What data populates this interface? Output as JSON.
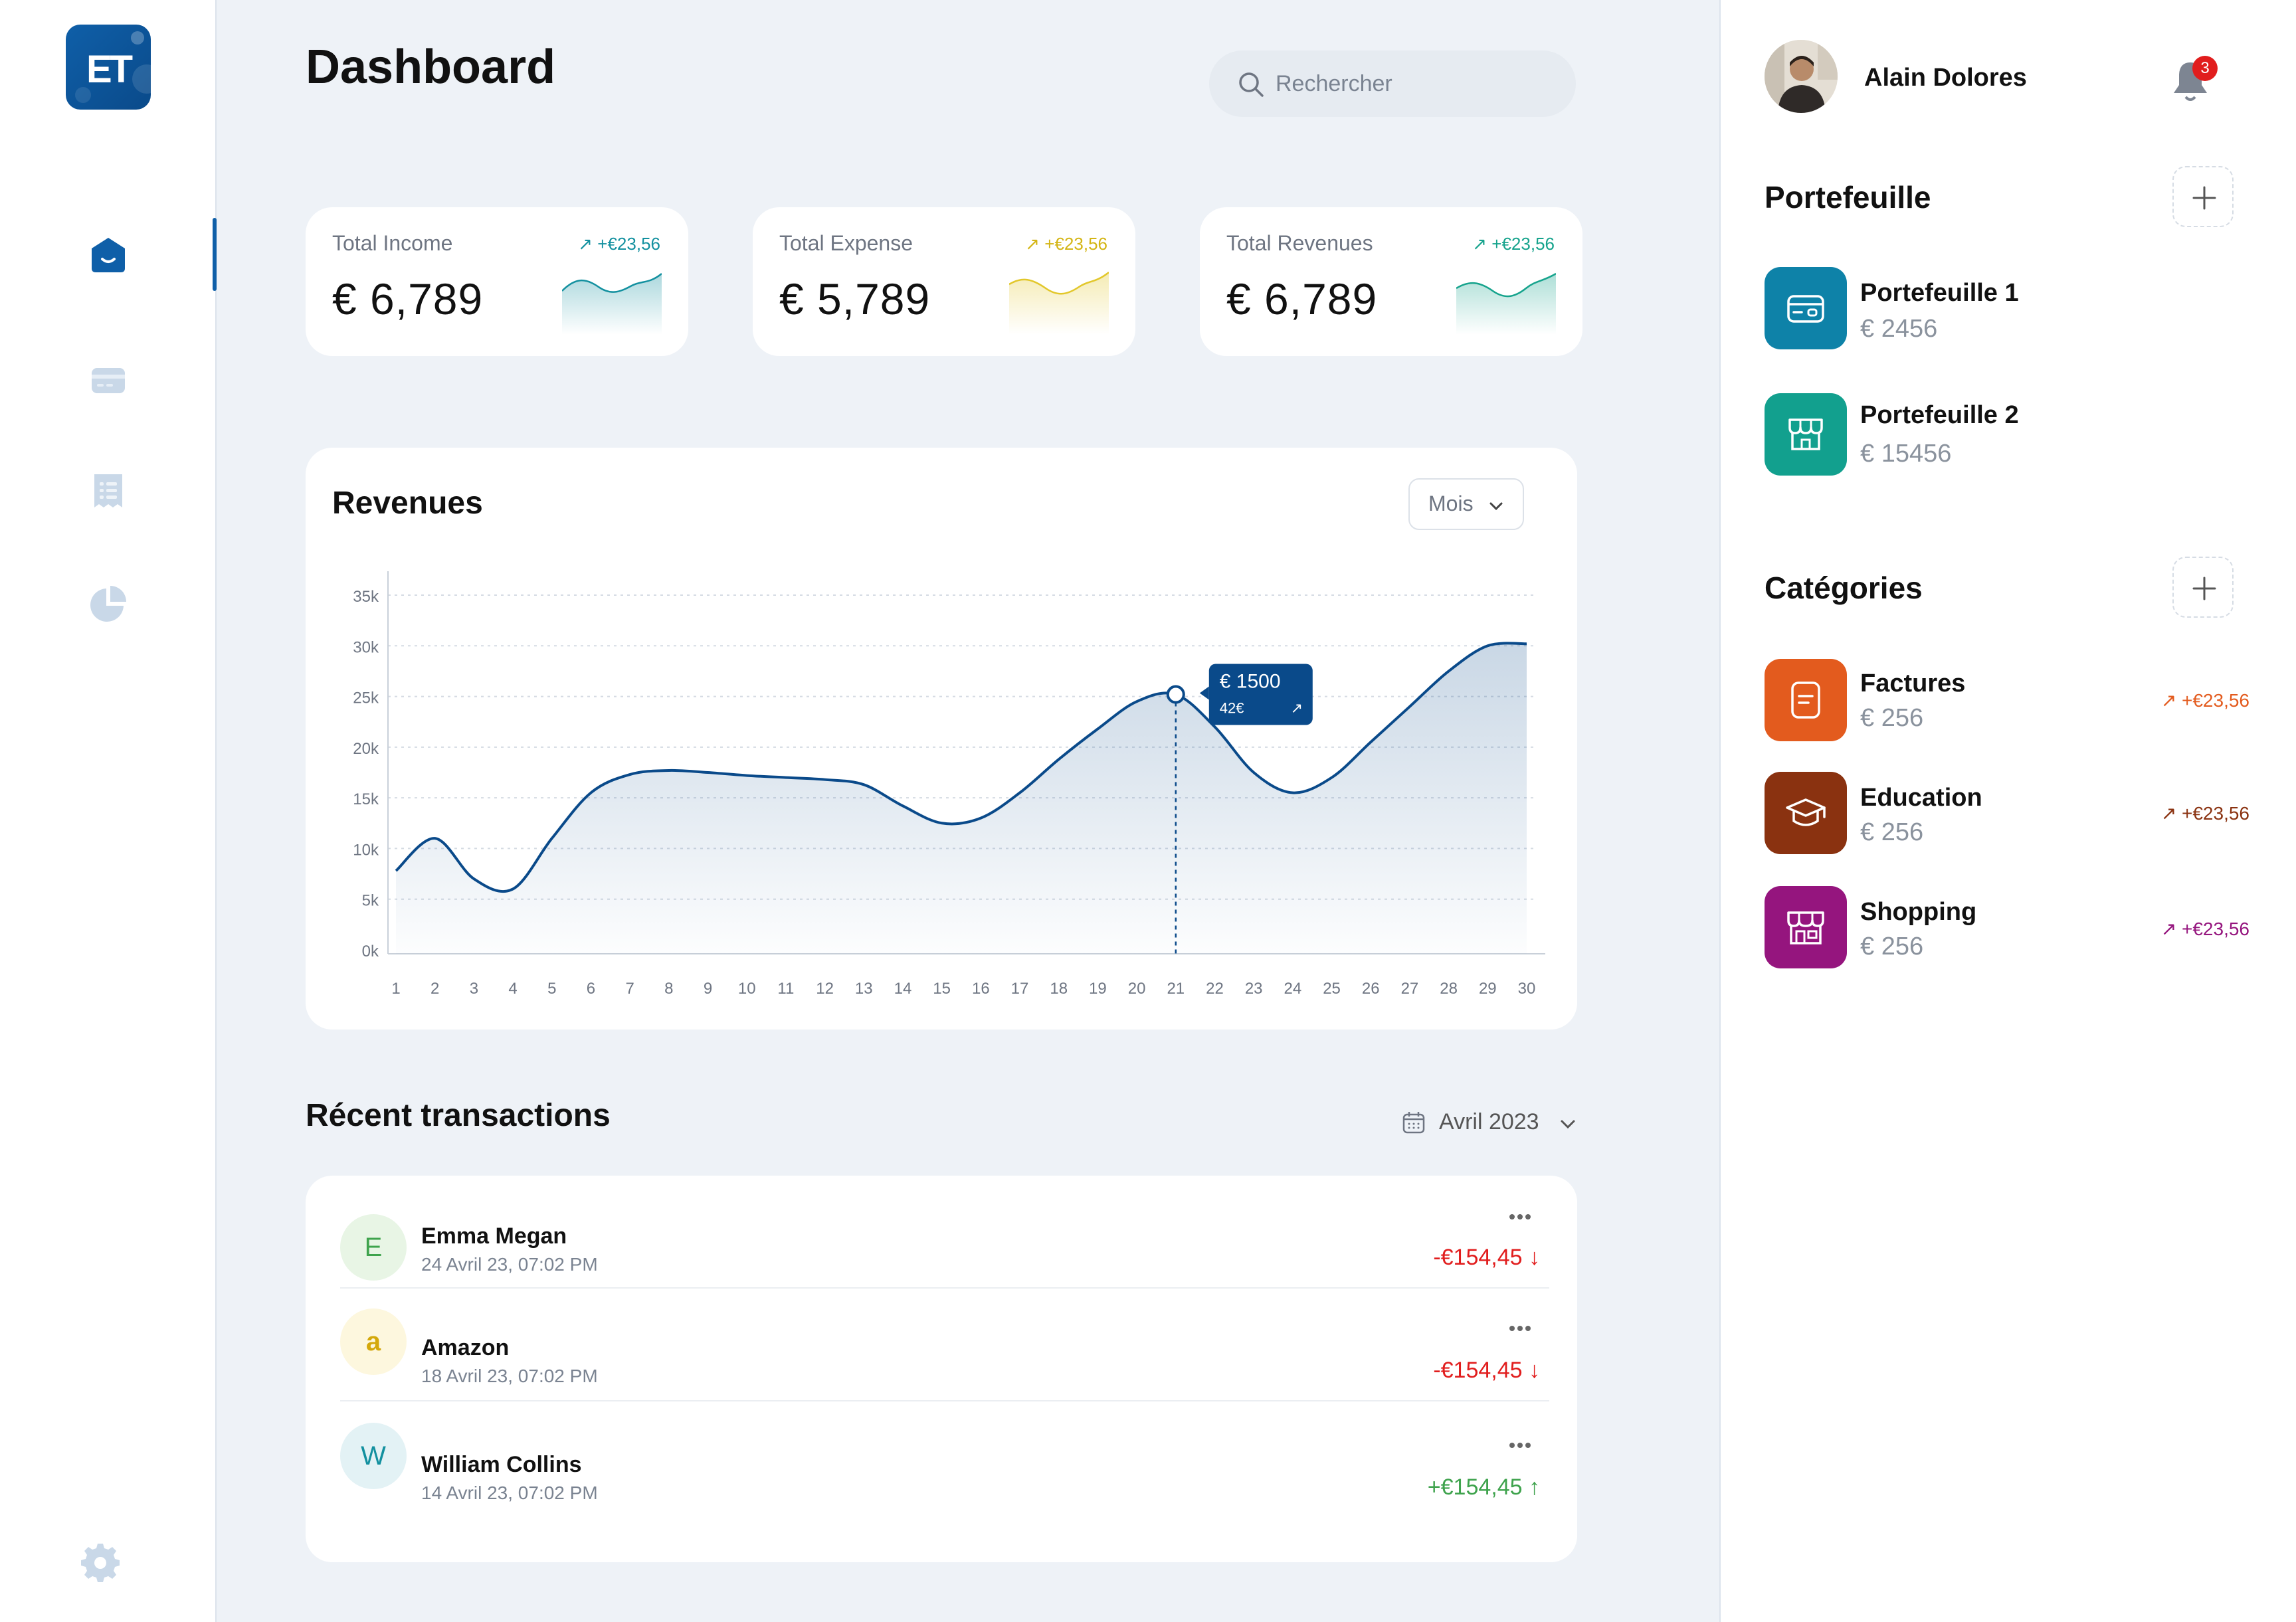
{
  "app": {
    "logo_text": "ET",
    "page_title": "Dashboard"
  },
  "search": {
    "placeholder": "Rechercher"
  },
  "sidebar": {
    "items": [
      {
        "icon": "home-icon",
        "active": true
      },
      {
        "icon": "card-icon",
        "active": false
      },
      {
        "icon": "receipt-icon",
        "active": false
      },
      {
        "icon": "pie-chart-icon",
        "active": false
      }
    ],
    "settings_icon": "gear-icon"
  },
  "stats": [
    {
      "label": "Total Income",
      "value": "€ 6,789",
      "delta": "+€23,56",
      "color": "#12909F"
    },
    {
      "label": "Total Expense",
      "value": "€ 5,789",
      "delta": "+€23,56",
      "color": "#E2C72A"
    },
    {
      "label": "Total Revenues",
      "value": "€ 6,789",
      "delta": "+€23,56",
      "color": "#15A38C"
    }
  ],
  "revenues": {
    "title": "Revenues",
    "period_select": "Mois",
    "tooltip": {
      "value": "€ 1500",
      "sub": "42€"
    }
  },
  "chart_data": {
    "type": "area",
    "title": "Revenues",
    "x": [
      1,
      2,
      3,
      4,
      5,
      6,
      7,
      8,
      9,
      10,
      11,
      12,
      13,
      14,
      15,
      16,
      17,
      18,
      19,
      20,
      21,
      22,
      23,
      24,
      25,
      26,
      27,
      28,
      29,
      30
    ],
    "ylim": [
      0,
      35000
    ],
    "y_ticks": [
      "0k",
      "5k",
      "10k",
      "15k",
      "20k",
      "25k",
      "30k",
      "35k"
    ],
    "series": [
      {
        "values": [
          7800,
          11000,
          7000,
          6000,
          11000,
          15500,
          17300,
          17700,
          17500,
          17200,
          17000,
          16800,
          16300,
          14200,
          12500,
          13000,
          15500,
          18800,
          21800,
          24500,
          25200,
          22000,
          17500,
          15500,
          17000,
          20500,
          24000,
          27500,
          30000,
          30200
        ],
        "color": "#0A4A8A"
      }
    ],
    "highlight_x": 21,
    "grid": true
  },
  "transactions": {
    "title": "Récent transactions",
    "filter_label": "Avril 2023",
    "rows": [
      {
        "initial": "E",
        "name": "Emma Megan",
        "date": "24 Avril 23, 07:02 PM",
        "amount": "-€154,45",
        "arrow": "↓",
        "avatar_bg": "#E8F5E5",
        "avatar_color": "#3FA34D",
        "amount_color": "#E11D1D"
      },
      {
        "initial": "a",
        "name": "Amazon",
        "date": "18 Avril 23, 07:02 PM",
        "amount": "-€154,45",
        "arrow": "↓",
        "avatar_bg": "#FDF7DE",
        "avatar_color": "#D4A80A",
        "amount_color": "#E11D1D"
      },
      {
        "initial": "W",
        "name": "William Collins",
        "date": "14 Avril 23, 07:02 PM",
        "amount": "+€154,45",
        "arrow": "↑",
        "avatar_bg": "#E3F2F5",
        "avatar_color": "#12909F",
        "amount_color": "#3FA34D"
      }
    ]
  },
  "user": {
    "name": "Alain Dolores",
    "notifications": "3"
  },
  "portefeuille": {
    "title": "Portefeuille",
    "items": [
      {
        "name": "Portefeuille 1",
        "value": "€ 2456",
        "color": "#0E82A8",
        "icon": "wallet-card-icon"
      },
      {
        "name": "Portefeuille 2",
        "value": "€ 15456",
        "color": "#12A08E",
        "icon": "store-icon"
      }
    ]
  },
  "categories": {
    "title": "Catégories",
    "items": [
      {
        "name": "Factures",
        "value": "€ 256",
        "delta": "+€23,56",
        "color": "#E35B1E",
        "icon": "bill-icon"
      },
      {
        "name": "Education",
        "value": "€ 256",
        "delta": "+€23,56",
        "color": "#8A3210",
        "icon": "graduation-cap-icon"
      },
      {
        "name": "Shopping",
        "value": "€ 256",
        "delta": "+€23,56",
        "color": "#95157E",
        "icon": "shop-icon"
      }
    ]
  }
}
